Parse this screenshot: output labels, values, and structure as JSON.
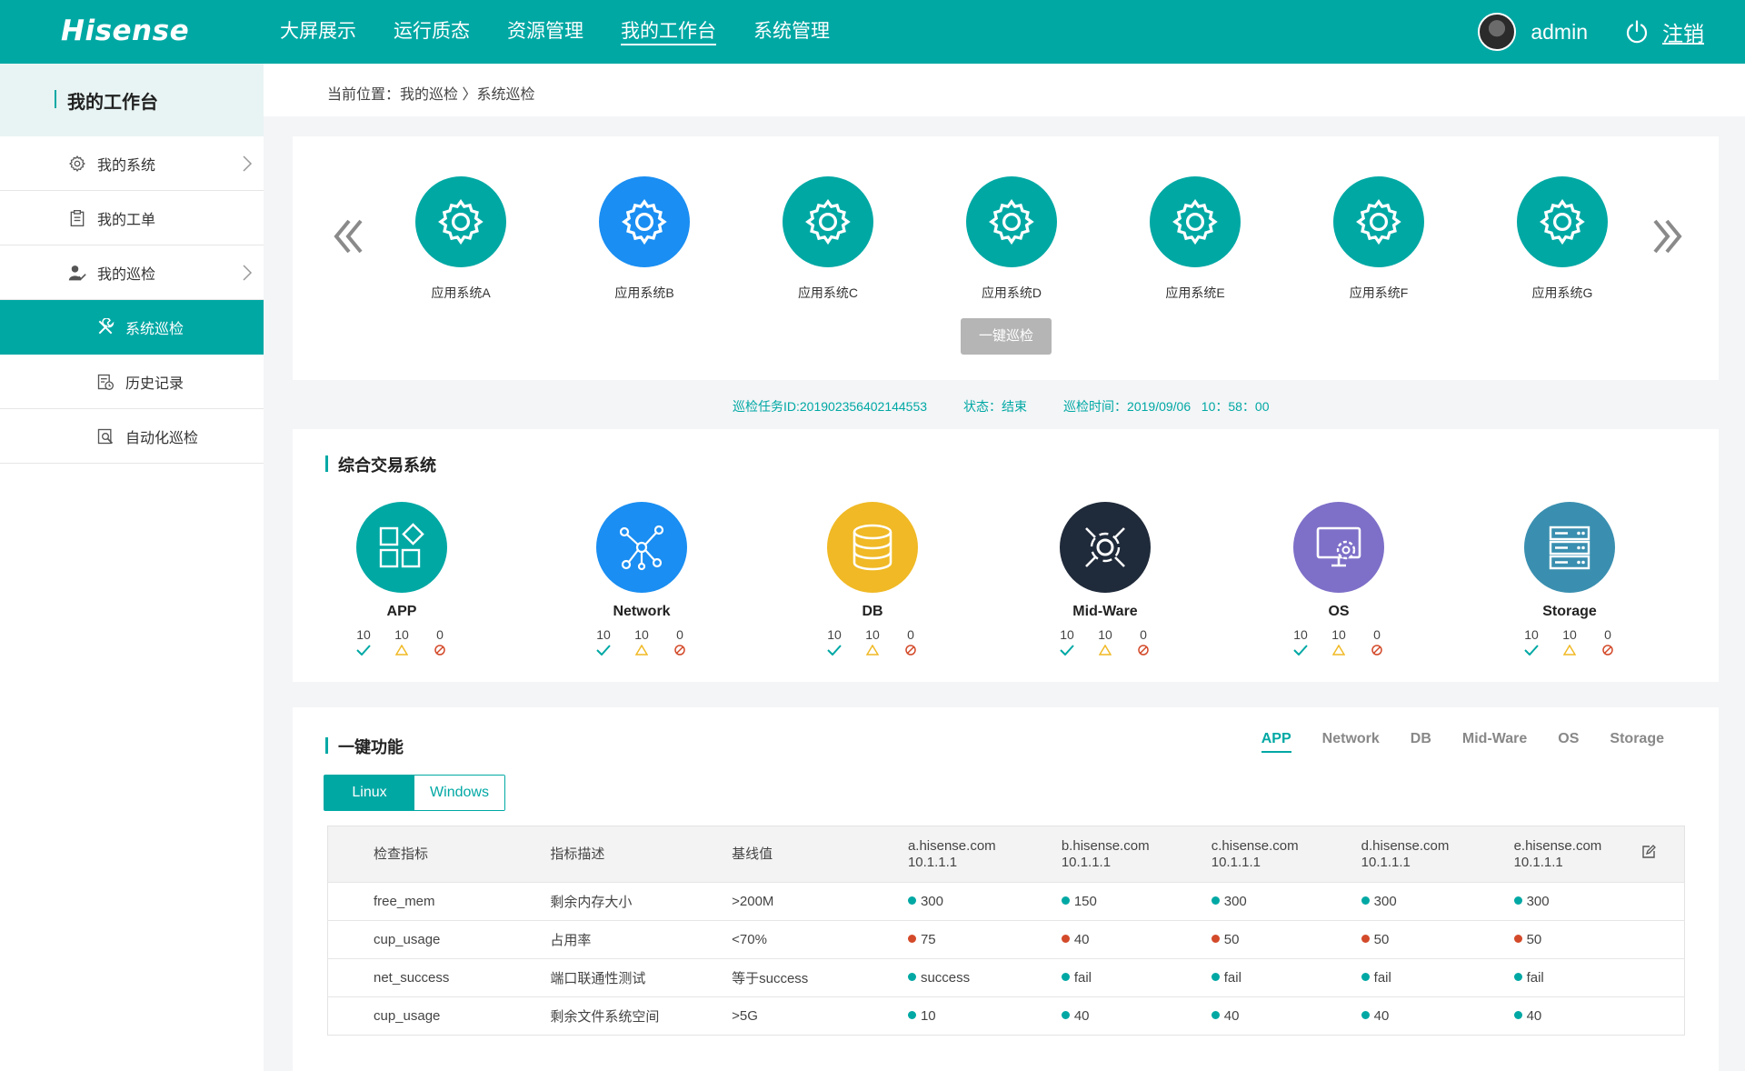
{
  "app": {
    "logo": "Hisense",
    "nav": [
      "大屏展示",
      "运行质态",
      "资源管理",
      "我的工作台",
      "系统管理"
    ],
    "active_nav": 3,
    "user": "admin",
    "logout": "注销"
  },
  "sidebar": {
    "title": "我的工作台",
    "items": [
      {
        "label": "我的系统",
        "icon": "gear-icon"
      },
      {
        "label": "我的工单",
        "icon": "clipboard-icon"
      },
      {
        "label": "我的巡检",
        "icon": "user-check-icon"
      },
      {
        "label": "系统巡检",
        "icon": "tools-icon"
      },
      {
        "label": "历史记录",
        "icon": "history-icon"
      },
      {
        "label": "自动化巡检",
        "icon": "search-doc-icon"
      }
    ]
  },
  "breadcrumb": "当前位置：我的巡检 〉系统巡检",
  "systems": {
    "items": [
      "应用系统A",
      "应用系统B",
      "应用系统C",
      "应用系统D",
      "应用系统E",
      "应用系统F",
      "应用系统G"
    ],
    "selected": 1,
    "onekey_button": "一键巡检"
  },
  "task": {
    "id": "巡检任务ID:201902356402144553",
    "status": "状态：结束",
    "time": "巡检时间：2019/09/06   10：58：00"
  },
  "overview": {
    "title": "综合交易系统",
    "categories": [
      {
        "name": "APP",
        "ok": "10",
        "warn": "10",
        "err": "0",
        "color": "#00a8a4"
      },
      {
        "name": "Network",
        "ok": "10",
        "warn": "10",
        "err": "0",
        "color": "#1a8ef2"
      },
      {
        "name": "DB",
        "ok": "10",
        "warn": "10",
        "err": "0",
        "color": "#f0b925"
      },
      {
        "name": "Mid-Ware",
        "ok": "10",
        "warn": "10",
        "err": "0",
        "color": "#1f2a3a"
      },
      {
        "name": "OS",
        "ok": "10",
        "warn": "10",
        "err": "0",
        "color": "#7e6fc8"
      },
      {
        "name": "Storage",
        "ok": "10",
        "warn": "10",
        "err": "0",
        "color": "#3a8fb0"
      }
    ]
  },
  "functions": {
    "title": "一键功能",
    "tabs": [
      "APP",
      "Network",
      "DB",
      "Mid-Ware",
      "OS",
      "Storage"
    ],
    "active_tab": 0,
    "os_options": [
      "Linux",
      "Windows"
    ],
    "headers": [
      "检查指标",
      "指标描述",
      "基线值"
    ],
    "hosts": [
      {
        "name": "a.hisense.com",
        "ip": "10.1.1.1"
      },
      {
        "name": "b.hisense.com",
        "ip": "10.1.1.1"
      },
      {
        "name": "c.hisense.com",
        "ip": "10.1.1.1"
      },
      {
        "name": "d.hisense.com",
        "ip": "10.1.1.1"
      },
      {
        "name": "e.hisense.com",
        "ip": "10.1.1.1"
      }
    ],
    "rows": [
      {
        "metric": "free_mem",
        "desc": "剩余内存大小",
        "baseline": ">200M",
        "values": [
          "300",
          "150",
          "300",
          "300",
          "300"
        ],
        "status": [
          "g",
          "g",
          "g",
          "g",
          "g"
        ]
      },
      {
        "metric": "cup_usage",
        "desc": "占用率",
        "baseline": "<70%",
        "values": [
          "75",
          "40",
          "50",
          "50",
          "50"
        ],
        "status": [
          "r",
          "r",
          "r",
          "r",
          "r"
        ]
      },
      {
        "metric": "net_success",
        "desc": "端口联通性测试",
        "baseline": "等于success",
        "values": [
          "success",
          "fail",
          "fail",
          "fail",
          "fail"
        ],
        "status": [
          "g",
          "g",
          "g",
          "g",
          "g"
        ]
      },
      {
        "metric": "cup_usage",
        "desc": "剩余文件系统空间",
        "baseline": ">5G",
        "values": [
          "10",
          "40",
          "40",
          "40",
          "40"
        ],
        "status": [
          "g",
          "g",
          "g",
          "g",
          "g"
        ]
      }
    ]
  }
}
